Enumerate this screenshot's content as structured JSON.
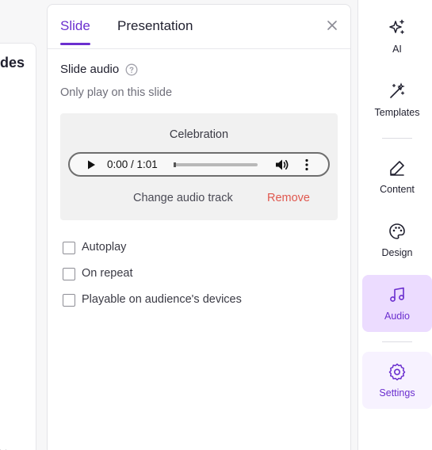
{
  "canvas": {
    "partial_title": "des"
  },
  "panel": {
    "tabs": [
      {
        "label": "Slide",
        "active": true
      },
      {
        "label": "Presentation",
        "active": false
      }
    ],
    "section_title": "Slide audio",
    "subtitle": "Only play on this slide",
    "audio": {
      "track_name": "Celebration",
      "time_display": "0:00 / 1:01",
      "progress": 0,
      "change_label": "Change audio track",
      "remove_label": "Remove"
    },
    "options": [
      {
        "label": "Autoplay",
        "checked": false
      },
      {
        "label": "On repeat",
        "checked": false
      },
      {
        "label": "Playable on audience's devices",
        "checked": false
      }
    ]
  },
  "sidebar": {
    "items": [
      {
        "label": "AI",
        "icon": "sparkles-icon"
      },
      {
        "label": "Templates",
        "icon": "magic-wand-icon"
      },
      {
        "label": "Content",
        "icon": "pencil-icon"
      },
      {
        "label": "Design",
        "icon": "palette-icon"
      },
      {
        "label": "Audio",
        "icon": "music-note-icon",
        "active": true
      },
      {
        "label": "Settings",
        "icon": "gear-icon"
      }
    ]
  },
  "colors": {
    "accent": "#6b2fcf",
    "active_bg": "#ecdcff",
    "remove": "#e0584f"
  }
}
